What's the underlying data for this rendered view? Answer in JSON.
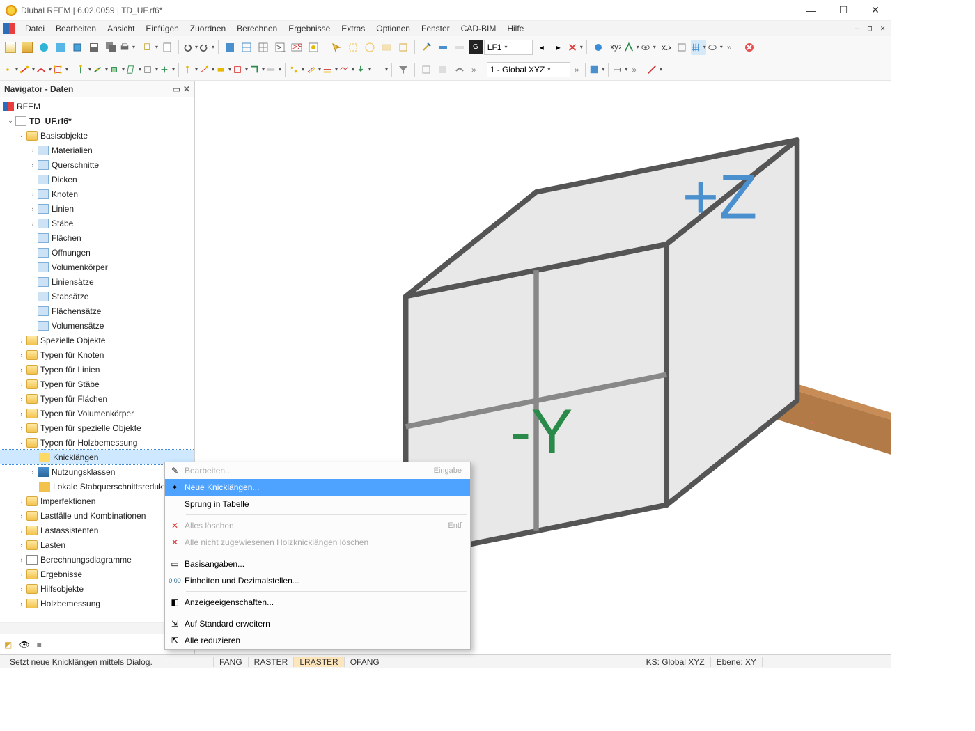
{
  "title": "Dlubal RFEM | 6.02.0059 | TD_UF.rf6*",
  "menu": [
    "Datei",
    "Bearbeiten",
    "Ansicht",
    "Einfügen",
    "Zuordnen",
    "Berechnen",
    "Ergebnisse",
    "Extras",
    "Optionen",
    "Fenster",
    "CAD-BIM",
    "Hilfe"
  ],
  "toolbar": {
    "loadcase_badge": "G",
    "loadcase": "LF1",
    "coord_system": "1 - Global XYZ"
  },
  "navigator": {
    "title": "Navigator - Daten",
    "root": "RFEM",
    "file": "TD_UF.rf6*",
    "basisobjekte": "Basisobjekte",
    "items_basis": [
      "Materialien",
      "Querschnitte",
      "Dicken",
      "Knoten",
      "Linien",
      "Stäbe",
      "Flächen",
      "Öffnungen",
      "Volumenkörper",
      "Liniensätze",
      "Stabsätze",
      "Flächensätze",
      "Volumensätze"
    ],
    "items_rest": [
      "Spezielle Objekte",
      "Typen für Knoten",
      "Typen für Linien",
      "Typen für Stäbe",
      "Typen für Flächen",
      "Typen für Volumenkörper",
      "Typen für spezielle Objekte"
    ],
    "holz": "Typen für Holzbemessung",
    "holz_items": [
      "Knicklängen",
      "Nutzungsklassen",
      "Lokale Stabquerschnittsreduktionen"
    ],
    "items_after": [
      "Imperfektionen",
      "Lastfälle und Kombinationen",
      "Lastassistenten",
      "Lasten",
      "Berechnungsdiagramme",
      "Ergebnisse",
      "Hilfsobjekte",
      "Holzbemessung"
    ]
  },
  "context": {
    "edit": "Bearbeiten...",
    "edit_sc": "Eingabe",
    "new": "Neue Knicklängen...",
    "jump": "Sprung in Tabelle",
    "delall": "Alles löschen",
    "delall_sc": "Entf",
    "delun": "Alle nicht zugewiesenen Holzknicklängen löschen",
    "base": "Basisangaben...",
    "units": "Einheiten und Dezimalstellen...",
    "disp": "Anzeigeeigenschaften...",
    "expand": "Auf Standard erweitern",
    "collapse": "Alle reduzieren"
  },
  "status": {
    "hint": "Setzt neue Knicklängen mittels Dialog.",
    "snap": [
      "FANG",
      "RASTER",
      "LRASTER",
      "OFANG"
    ],
    "ks": "KS: Global XYZ",
    "ebene": "Ebene: XY"
  }
}
